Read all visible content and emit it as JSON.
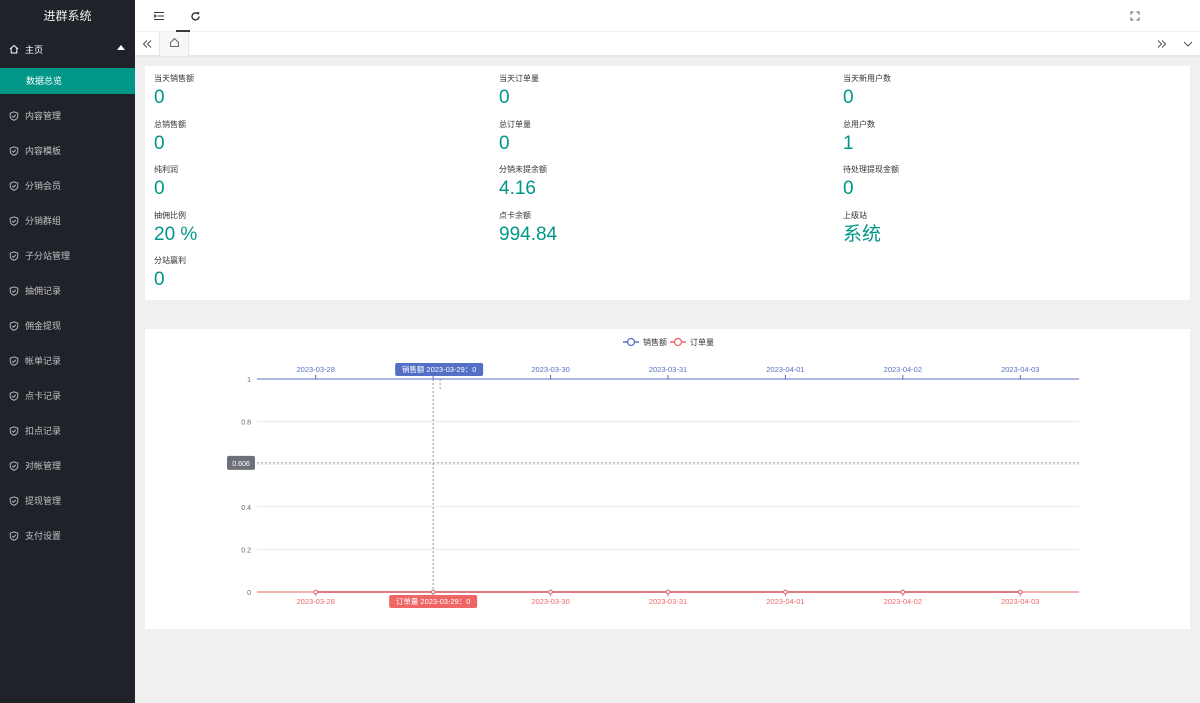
{
  "app": {
    "title": "进群系统"
  },
  "sidebar": {
    "home_label": "主页",
    "sub_active": "数据总览",
    "items": [
      {
        "label": "内容管理"
      },
      {
        "label": "内容模板"
      },
      {
        "label": "分销会员"
      },
      {
        "label": "分销群组"
      },
      {
        "label": "子分站管理"
      },
      {
        "label": "抽佣记录"
      },
      {
        "label": "佣金提现"
      },
      {
        "label": "帐单记录"
      },
      {
        "label": "点卡记录"
      },
      {
        "label": "扣点记录"
      },
      {
        "label": "对帐管理"
      },
      {
        "label": "提现管理"
      },
      {
        "label": "支付设置"
      }
    ]
  },
  "header": {
    "icons": [
      "menu-fold-icon",
      "refresh-icon",
      "fullscreen-icon"
    ]
  },
  "tabs": {
    "icons": [
      "double-left-icon",
      "home-icon",
      "double-right-icon",
      "chevron-down-icon"
    ]
  },
  "stats": [
    {
      "label": "当天销售额",
      "value": "0"
    },
    {
      "label": "当天订单量",
      "value": "0"
    },
    {
      "label": "当天新用户数",
      "value": "0"
    },
    {
      "label": "总销售额",
      "value": "0"
    },
    {
      "label": "总订单量",
      "value": "0"
    },
    {
      "label": "总用户数",
      "value": "1"
    },
    {
      "label": "纯利润",
      "value": "0"
    },
    {
      "label": "分销未提余额",
      "value": "4.16"
    },
    {
      "label": "待处理提现金额",
      "value": "0"
    },
    {
      "label": "抽佣比例",
      "value": "20 %"
    },
    {
      "label": "点卡余额",
      "value": "994.84"
    },
    {
      "label": "上级站",
      "value": "系统"
    },
    {
      "label": "分站赢利",
      "value": "0"
    }
  ],
  "colors": {
    "accent": "#009688",
    "sidebar": "#20222a",
    "sales": "#5470c6",
    "orders": "#ee6666"
  },
  "chart_data": {
    "type": "line",
    "x": [
      "2023-03-28",
      "2023-03-29",
      "2023-03-30",
      "2023-03-31",
      "2023-04-01",
      "2023-04-02",
      "2023-04-03"
    ],
    "series": [
      {
        "name": "销售额",
        "values": [
          0,
          0,
          0,
          0,
          0,
          0,
          0
        ],
        "color": "#5470c6"
      },
      {
        "name": "订单量",
        "values": [
          0,
          0,
          0,
          0,
          0,
          0,
          0
        ],
        "color": "#ee6666"
      }
    ],
    "yticks": [
      "0",
      "0.2",
      "0.4",
      "0.6",
      "0.8",
      "1"
    ],
    "ylim": [
      0,
      1
    ],
    "legend_position": "top-center",
    "grid": true,
    "tooltip": {
      "sales_text": "销售额  2023-03-29：0",
      "orders_text": "订单量  2023-03-29：0",
      "y_pointer": "0.606"
    }
  }
}
